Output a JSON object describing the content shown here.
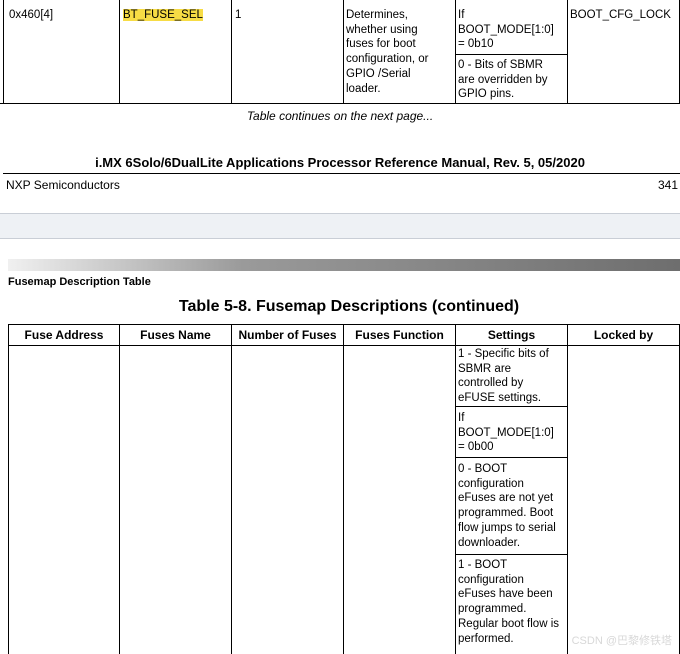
{
  "top_row": {
    "fuse_address": "0x460[4]",
    "fuse_name": "BT_FUSE_SEL",
    "number_of_fuses": "1",
    "function_lines": [
      "Determines,",
      "whether using",
      "fuses for boot",
      "configuration, or",
      "GPIO /Serial",
      "loader."
    ],
    "settings_a_lines": [
      "If",
      "BOOT_MODE[1:0]",
      "= 0b10"
    ],
    "settings_b_lines": [
      "0 - Bits of SBMR",
      "are overridden by",
      "GPIO pins."
    ],
    "locked_by": "BOOT_CFG_LOCK"
  },
  "continues_note": "Table continues on the next page...",
  "footer": {
    "manual_title": "i.MX 6Solo/6DualLite Applications Processor Reference Manual, Rev. 5, 05/2020",
    "company": "NXP Semiconductors",
    "page_number": "341"
  },
  "section_header": "Fusemap Description Table",
  "table_title": "Table 5-8.  Fusemap Descriptions (continued)",
  "columns": [
    "Fuse Address",
    "Fuses Name",
    "Number of Fuses",
    "Fuses Function",
    "Settings",
    "Locked by"
  ],
  "settings": {
    "block1": [
      "1 - Specific bits of",
      "SBMR are",
      "controlled by",
      "eFUSE settings."
    ],
    "block2": [
      "If",
      "BOOT_MODE[1:0]",
      "= 0b00"
    ],
    "block3": [
      "0 - BOOT",
      "configuration",
      "eFuses are not yet",
      "programmed. Boot",
      "flow jumps to serial",
      "downloader."
    ],
    "block4": [
      "1 - BOOT",
      "configuration",
      "eFuses have been",
      "programmed.",
      "Regular boot flow is",
      "performed."
    ]
  },
  "watermark": "CSDN @巴黎修铁塔"
}
